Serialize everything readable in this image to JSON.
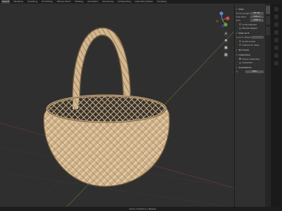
{
  "workspace_tabs": [
    "Layout",
    "Modeling",
    "Sculpting",
    "UV Editing",
    "Texture Paint",
    "Shading",
    "Animation",
    "Rendering",
    "Compositing",
    "Geometry Nodes",
    "Scripting"
  ],
  "active_tab_index": 0,
  "sidebar": {
    "view_header": "View",
    "focal_label": "Focal Length",
    "focal_value": "50 mm",
    "clip_start_label": "Clip Start",
    "clip_start_value": "0.01 m",
    "clip_end_label": "End",
    "clip_end_value": "1000 m",
    "local_camera_label": "Local Camera",
    "render_region_label": "Render Region",
    "view_lock_header": "View Lock",
    "lock_to_object_label": "Lock to Object",
    "lock_label": "Lock",
    "to_3d_cursor_label": "To 3D Cursor",
    "camera_to_view_label": "Camera to View",
    "cursor_header": "3D Cursor",
    "collections_header": "Collections",
    "scene_collection_label": "Scene Collection",
    "collection_label": "Collection",
    "annotations_header": "Annotations",
    "annotations_value": "Note"
  },
  "statusbar": {
    "text": "Scene Collection | Basket"
  },
  "nav_icons": [
    "zoom-icon",
    "pan-icon",
    "camera-icon",
    "grid-icon"
  ]
}
